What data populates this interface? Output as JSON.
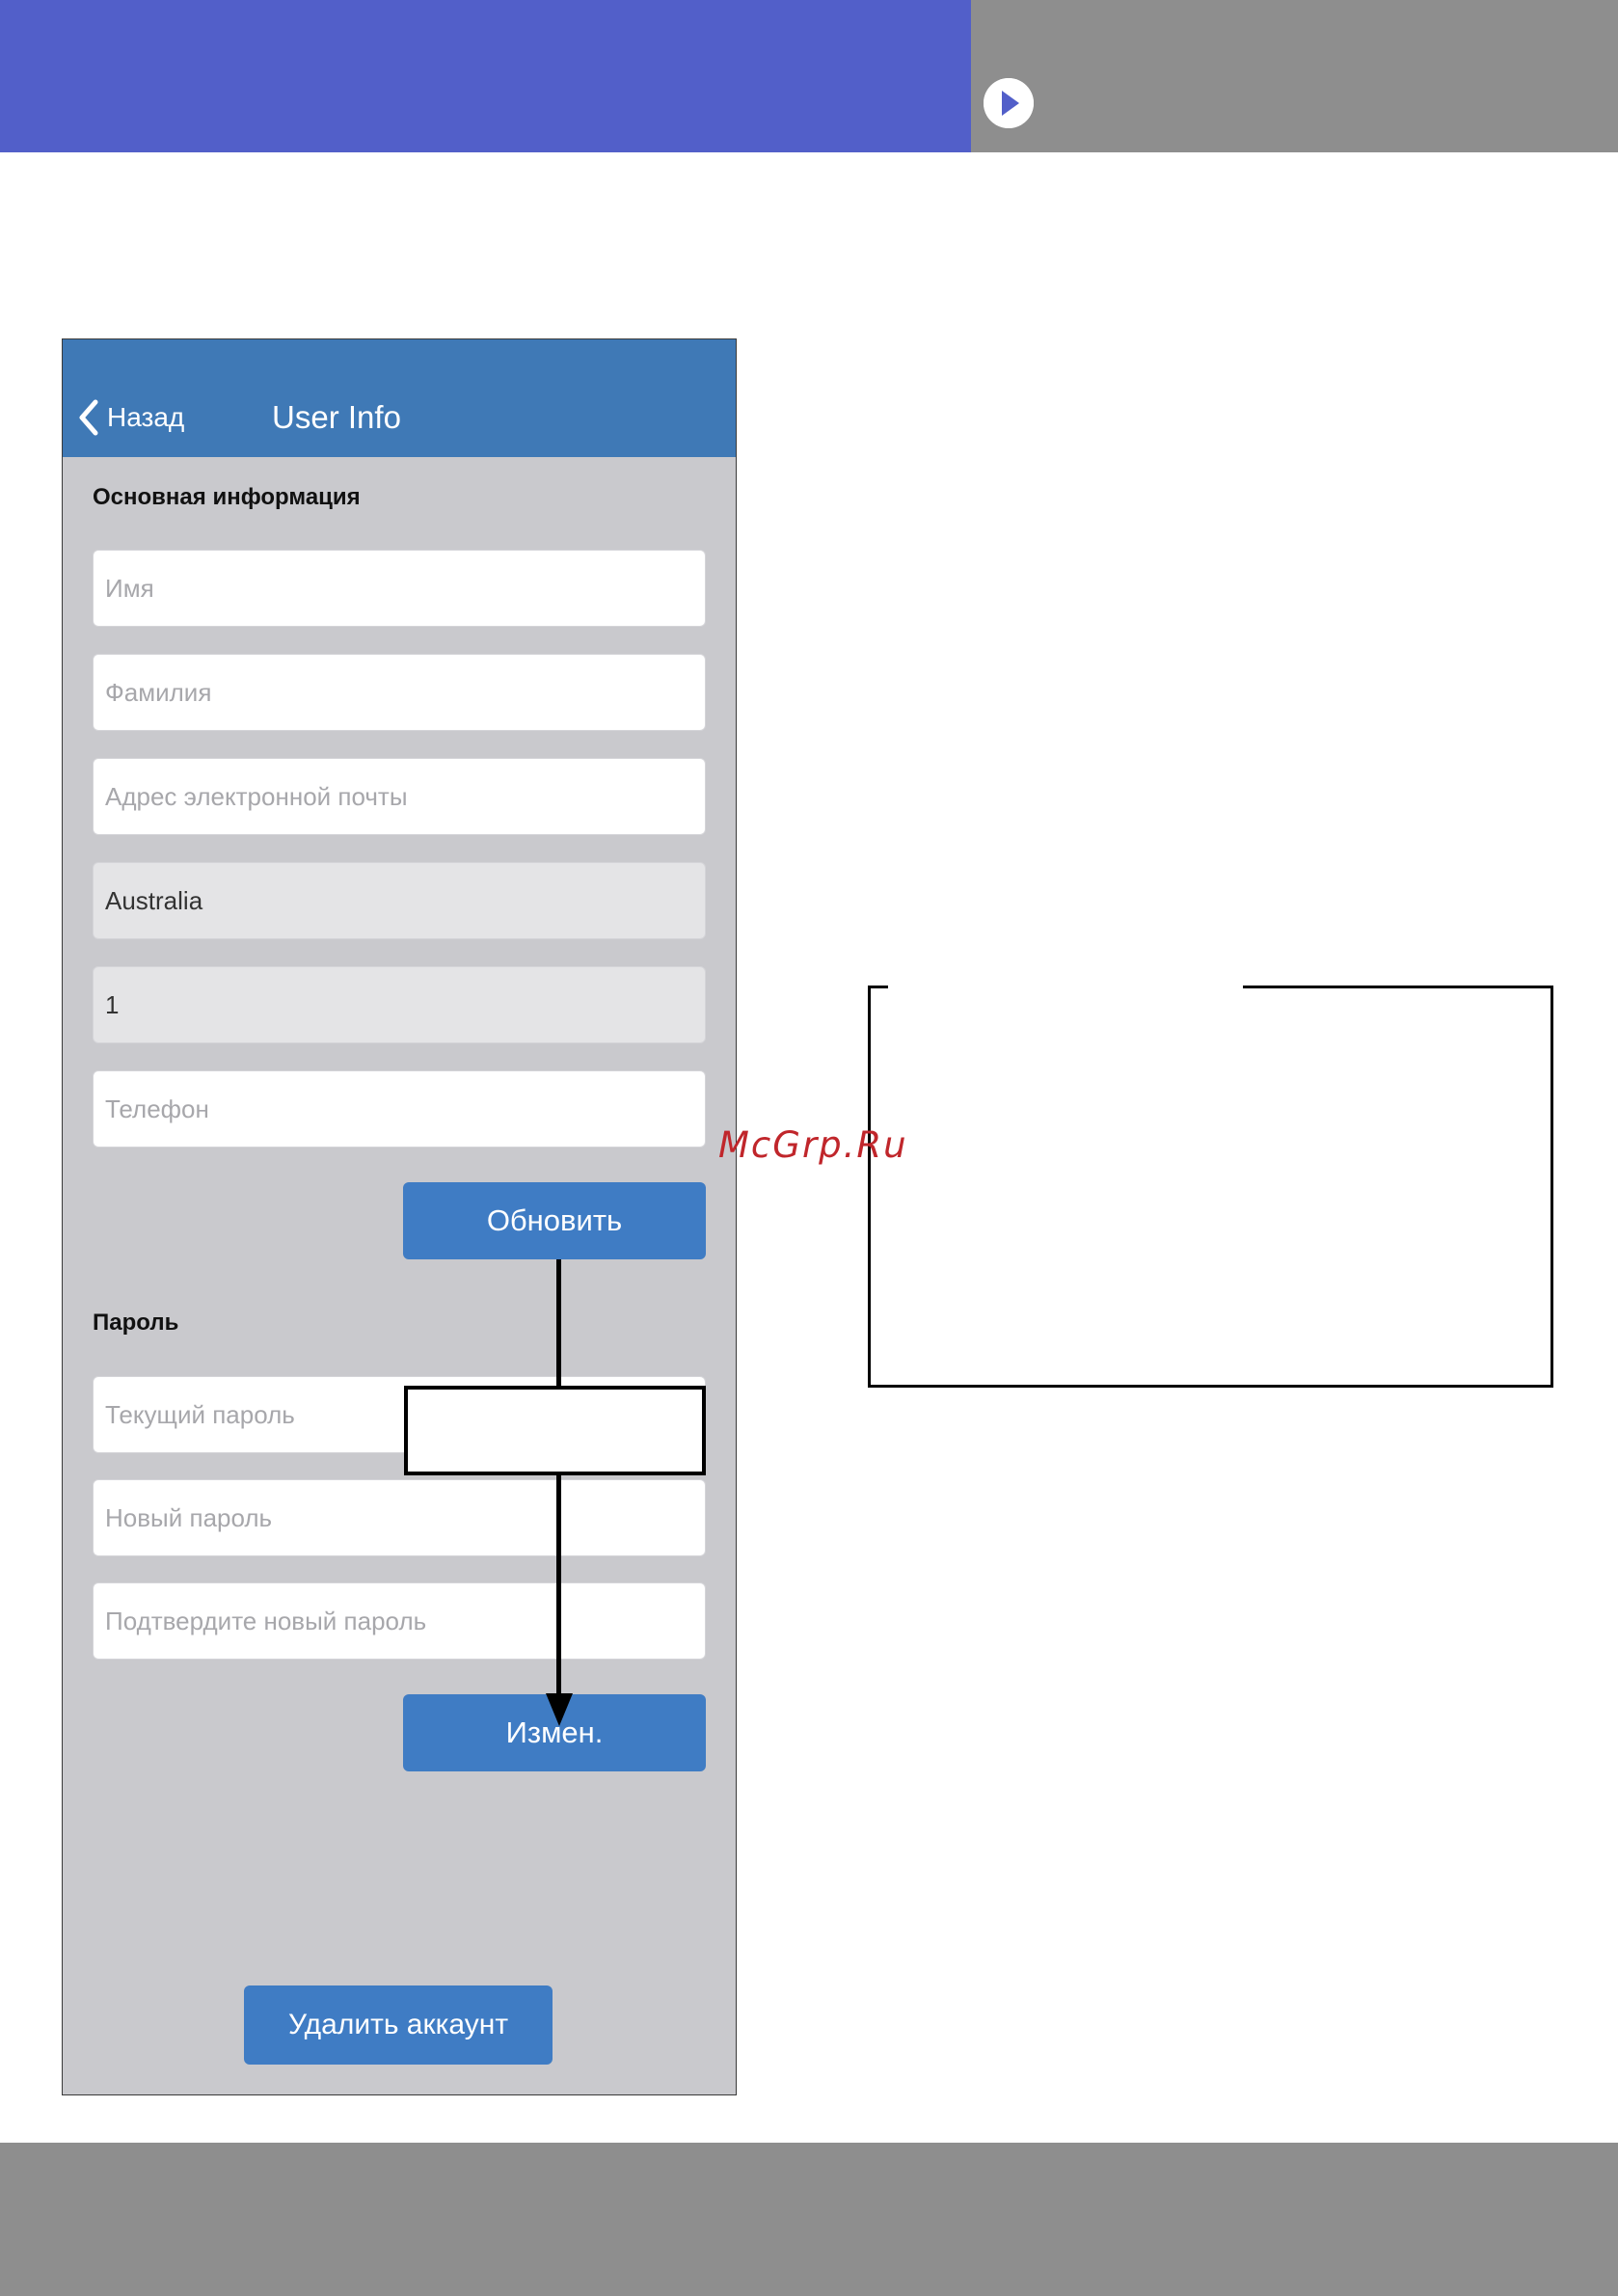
{
  "colors": {
    "header_blue": "#525fc9",
    "band_gray": "#8e8e8e",
    "nav_blue": "#3f79b6",
    "button_blue": "#3f7cc4",
    "screen_bg": "#c9c9cd",
    "watermark_red": "#c0262b"
  },
  "header": {
    "play_icon": "play-circle-icon"
  },
  "app": {
    "nav": {
      "back_label": "Назад",
      "back_icon": "chevron-left-icon",
      "title": "User Info"
    },
    "basic_info": {
      "section_title": "Основная информация",
      "first_name_placeholder": "Имя",
      "last_name_placeholder": "Фамилия",
      "email_placeholder": "Адрес электронной почты",
      "country_value": "Australia",
      "country_code_value": "1",
      "phone_placeholder": "Телефон",
      "update_button": "Обновить"
    },
    "password": {
      "section_title": "Пароль",
      "current_placeholder": "Текущий пароль",
      "new_placeholder": "Новый пароль",
      "confirm_placeholder": "Подтвердите новый пароль",
      "change_button": "Измен."
    },
    "delete_button": "Удалить аккаунт"
  },
  "watermark": "McGrp.Ru"
}
